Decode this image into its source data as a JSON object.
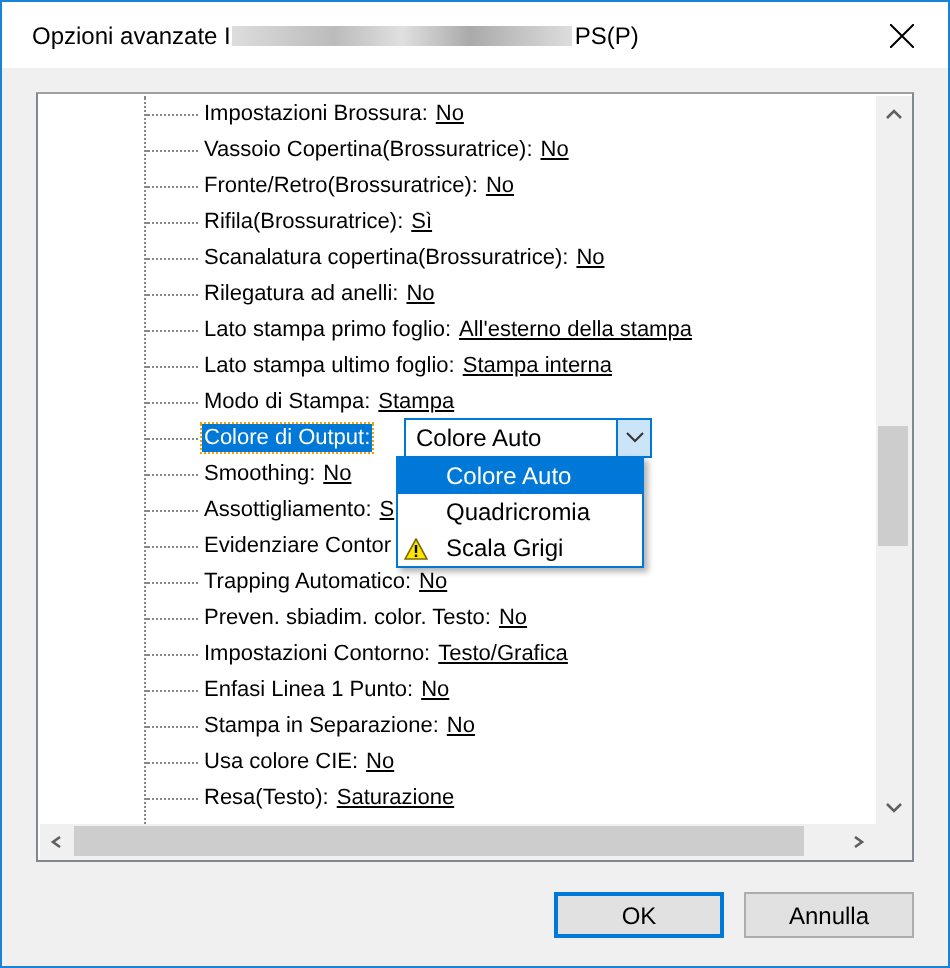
{
  "window": {
    "title_start": "Opzioni avanzate I",
    "title_end": "PS(P)"
  },
  "tree": {
    "rows": [
      {
        "kind": "setting",
        "label": "Impostazioni Brossura:",
        "value": "No"
      },
      {
        "kind": "setting",
        "label": "Vassoio Copertina(Brossuratrice):",
        "value": "No"
      },
      {
        "kind": "setting",
        "label": "Fronte/Retro(Brossuratrice):",
        "value": "No"
      },
      {
        "kind": "setting",
        "label": "Rifila(Brossuratrice):",
        "value": "Sì"
      },
      {
        "kind": "setting",
        "label": "Scanalatura copertina(Brossuratrice):",
        "value": "No"
      },
      {
        "kind": "setting",
        "label": "Rilegatura ad anelli:",
        "value": "No"
      },
      {
        "kind": "setting",
        "label": "Lato stampa primo foglio:",
        "value": "All'esterno della stampa"
      },
      {
        "kind": "setting",
        "label": "Lato stampa ultimo foglio:",
        "value": "Stampa interna"
      },
      {
        "kind": "setting",
        "label": "Modo di Stampa:",
        "value": "Stampa"
      },
      {
        "kind": "dropdown",
        "label": "Colore di Output:",
        "value": "Colore Auto",
        "selected": true,
        "expanded": true,
        "options": [
          {
            "label": "Colore Auto",
            "selected": true,
            "warning": false
          },
          {
            "label": "Quadricromia",
            "selected": false,
            "warning": false
          },
          {
            "label": "Scala Grigi",
            "selected": false,
            "warning": true
          }
        ]
      },
      {
        "kind": "setting",
        "label": "Smoothing:",
        "value": "No"
      },
      {
        "kind": "setting",
        "label": "Assottigliamento:",
        "value": "S"
      },
      {
        "kind": "setting",
        "label": "Evidenziare Contor"
      },
      {
        "kind": "setting",
        "label": "Trapping Automatico:",
        "value": "No"
      },
      {
        "kind": "setting",
        "label": "Preven. sbiadim. color. Testo:",
        "value": "No"
      },
      {
        "kind": "setting",
        "label": "Impostazioni Contorno:",
        "value": "Testo/Grafica"
      },
      {
        "kind": "setting",
        "label": "Enfasi Linea 1 Punto:",
        "value": "No"
      },
      {
        "kind": "setting",
        "label": "Stampa in Separazione:",
        "value": "No"
      },
      {
        "kind": "setting",
        "label": "Usa colore CIE:",
        "value": "No"
      },
      {
        "kind": "setting",
        "label": "Resa(Testo):",
        "value": "Saturazione"
      }
    ]
  },
  "buttons": [
    {
      "label": "OK",
      "default": true
    },
    {
      "label": "Annulla",
      "default": false
    }
  ]
}
